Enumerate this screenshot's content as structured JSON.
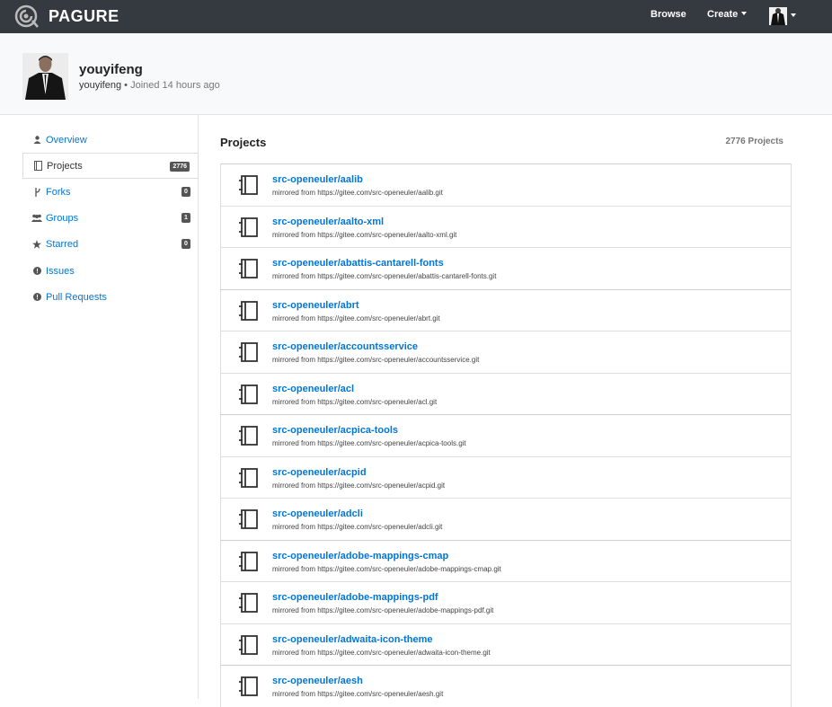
{
  "navbar": {
    "brand": "PAGURE",
    "browse": "Browse",
    "create": "Create"
  },
  "profile": {
    "name": "youyifeng",
    "handle": "youyifeng",
    "separator": "•",
    "joined": "Joined 14 hours ago"
  },
  "sidebar": {
    "items": [
      {
        "label": "Overview",
        "icon": "user-icon",
        "badge": null
      },
      {
        "label": "Projects",
        "icon": "book-icon",
        "badge": "2776"
      },
      {
        "label": "Forks",
        "icon": "fork-icon",
        "badge": "0"
      },
      {
        "label": "Groups",
        "icon": "users-icon",
        "badge": "1"
      },
      {
        "label": "Starred",
        "icon": "star-icon",
        "badge": "0"
      },
      {
        "label": "Issues",
        "icon": "exclamation-icon",
        "badge": null
      },
      {
        "label": "Pull Requests",
        "icon": "exclamation-icon",
        "badge": null
      }
    ]
  },
  "main": {
    "title": "Projects",
    "count": "2776 Projects",
    "projects": [
      {
        "name": "src-openeuler/aalib",
        "desc": "mirrored from https://gitee.com/src-openeuler/aalib.git"
      },
      {
        "name": "src-openeuler/aalto-xml",
        "desc": "mirrored from https://gitee.com/src-openeuler/aalto-xml.git"
      },
      {
        "name": "src-openeuler/abattis-cantarell-fonts",
        "desc": "mirrored from https://gitee.com/src-openeuler/abattis-cantarell-fonts.git"
      },
      {
        "name": "src-openeuler/abrt",
        "desc": "mirrored from https://gitee.com/src-openeuler/abrt.git"
      },
      {
        "name": "src-openeuler/accountsservice",
        "desc": "mirrored from https://gitee.com/src-openeuler/accountsservice.git"
      },
      {
        "name": "src-openeuler/acl",
        "desc": "mirrored from https://gitee.com/src-openeuler/acl.git"
      },
      {
        "name": "src-openeuler/acpica-tools",
        "desc": "mirrored from https://gitee.com/src-openeuler/acpica-tools.git"
      },
      {
        "name": "src-openeuler/acpid",
        "desc": "mirrored from https://gitee.com/src-openeuler/acpid.git"
      },
      {
        "name": "src-openeuler/adcli",
        "desc": "mirrored from https://gitee.com/src-openeuler/adcli.git"
      },
      {
        "name": "src-openeuler/adobe-mappings-cmap",
        "desc": "mirrored from https://gitee.com/src-openeuler/adobe-mappings-cmap.git"
      },
      {
        "name": "src-openeuler/adobe-mappings-pdf",
        "desc": "mirrored from https://gitee.com/src-openeuler/adobe-mappings-pdf.git"
      },
      {
        "name": "src-openeuler/adwaita-icon-theme",
        "desc": "mirrored from https://gitee.com/src-openeuler/adwaita-icon-theme.git"
      },
      {
        "name": "src-openeuler/aesh",
        "desc": "mirrored from https://gitee.com/src-openeuler/aesh.git"
      }
    ]
  },
  "colors": {
    "navbar": "#343a40",
    "link": "#0275d8",
    "badge": "#555555"
  }
}
